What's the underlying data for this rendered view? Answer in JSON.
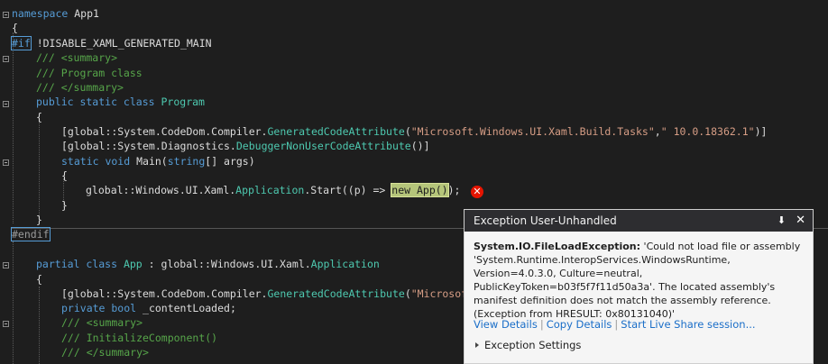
{
  "code": {
    "l1a": "namespace",
    "l1b": " App1",
    "l2": "{",
    "l3a": "#if",
    "l3b": " !DISABLE_XAML_GENERATED_MAIN",
    "l4": "/// <summary>",
    "l5": "/// Program class",
    "l6": "/// </summary>",
    "l7a": "public static class",
    "l7b": "Program",
    "l8": "{",
    "l9a": "[global::System.CodeDom.Compiler.",
    "l9b": "GeneratedCodeAttribute",
    "l9c": "(",
    "l9d": "\"Microsoft.Windows.UI.Xaml.Build.Tasks\"",
    "l9e": ",",
    "l9f": "\" 10.0.18362.1\"",
    "l9g": ")]",
    "l10a": "[global::System.Diagnostics.",
    "l10b": "DebuggerNonUserCodeAttribute",
    "l10c": "()]",
    "l11a": "static void",
    "l11b": " Main(",
    "l11c": "string",
    "l11d": "[] args)",
    "l12": "{",
    "l13a": "global::Windows.UI.Xaml.",
    "l13b": "Application",
    "l13c": ".Start((p) => ",
    "l13d": "new App()",
    "l13e": ");",
    "l14": "}",
    "l15": "}",
    "l16": "#endif",
    "l17a": "partial class",
    "l17b": "App",
    "l17c": " : global::Windows.UI.Xaml.",
    "l17d": "Application",
    "l18": "{",
    "l19a": "[global::System.CodeDom.Compiler.",
    "l19b": "GeneratedCodeAttribute",
    "l19c": "(",
    "l19d": "\"Microsof",
    "l20a": "private bool",
    "l20b": " _contentLoaded;",
    "l21": "/// <summary>",
    "l22": "/// InitializeComponent()",
    "l23": "/// </summary>"
  },
  "popup": {
    "title": "Exception User-Unhandled",
    "exception_type": "System.IO.FileLoadException:",
    "message": " 'Could not load file or assembly 'System.Runtime.InteropServices.WindowsRuntime, Version=4.0.3.0, Culture=neutral, PublicKeyToken=b03f5f7f11d50a3a'. The located assembly's manifest definition does not match the assembly reference. (Exception from HRESULT: 0x80131040)'",
    "links": [
      "View Details",
      "Copy Details",
      "Start Live Share session..."
    ],
    "separator": "|",
    "settings_label": "Exception Settings",
    "pin_glyph": "⬇",
    "close_glyph": "✕"
  },
  "error_glyph": "✕"
}
